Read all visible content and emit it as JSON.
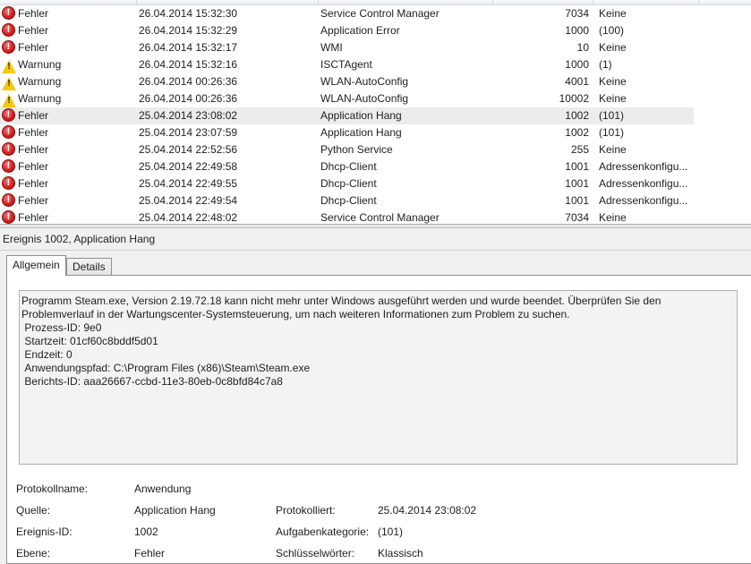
{
  "event_list": {
    "rows": [
      {
        "level": "Fehler",
        "type": "error",
        "date": "26.04.2014 15:32:30",
        "source": "Service Control Manager",
        "event_id": "7034",
        "task": "Keine"
      },
      {
        "level": "Fehler",
        "type": "error",
        "date": "26.04.2014 15:32:29",
        "source": "Application Error",
        "event_id": "1000",
        "task": "(100)"
      },
      {
        "level": "Fehler",
        "type": "error",
        "date": "26.04.2014 15:32:17",
        "source": "WMI",
        "event_id": "10",
        "task": "Keine"
      },
      {
        "level": "Warnung",
        "type": "warning",
        "date": "26.04.2014 15:32:16",
        "source": "ISCTAgent",
        "event_id": "1000",
        "task": "(1)"
      },
      {
        "level": "Warnung",
        "type": "warning",
        "date": "26.04.2014 00:26:36",
        "source": "WLAN-AutoConfig",
        "event_id": "4001",
        "task": "Keine"
      },
      {
        "level": "Warnung",
        "type": "warning",
        "date": "26.04.2014 00:26:36",
        "source": "WLAN-AutoConfig",
        "event_id": "10002",
        "task": "Keine"
      },
      {
        "level": "Fehler",
        "type": "error",
        "date": "25.04.2014 23:08:02",
        "source": "Application Hang",
        "event_id": "1002",
        "task": "(101)",
        "selected": true
      },
      {
        "level": "Fehler",
        "type": "error",
        "date": "25.04.2014 23:07:59",
        "source": "Application Hang",
        "event_id": "1002",
        "task": "(101)"
      },
      {
        "level": "Fehler",
        "type": "error",
        "date": "25.04.2014 22:52:56",
        "source": "Python Service",
        "event_id": "255",
        "task": "Keine"
      },
      {
        "level": "Fehler",
        "type": "error",
        "date": "25.04.2014 22:49:58",
        "source": "Dhcp-Client",
        "event_id": "1001",
        "task": "Adressenkonfigu..."
      },
      {
        "level": "Fehler",
        "type": "error",
        "date": "25.04.2014 22:49:55",
        "source": "Dhcp-Client",
        "event_id": "1001",
        "task": "Adressenkonfigu..."
      },
      {
        "level": "Fehler",
        "type": "error",
        "date": "25.04.2014 22:49:54",
        "source": "Dhcp-Client",
        "event_id": "1001",
        "task": "Adressenkonfigu..."
      },
      {
        "level": "Fehler",
        "type": "error",
        "date": "25.04.2014 22:48:02",
        "source": "Service Control Manager",
        "event_id": "7034",
        "task": "Keine"
      }
    ]
  },
  "detail": {
    "title": "Ereignis 1002, Application Hang",
    "tabs": {
      "general": "Allgemein",
      "details": "Details"
    },
    "description": "Programm Steam.exe, Version 2.19.72.18 kann nicht mehr unter Windows ausgeführt werden und wurde beendet. Überprüfen Sie den Problemverlauf in der Wartungscenter-Systemsteuerung, um nach weiteren Informationen zum Problem zu suchen.\n Prozess-ID: 9e0\n Startzeit: 01cf60c8bddf5d01\n Endzeit: 0\n Anwendungspfad: C:\\Program Files (x86)\\Steam\\Steam.exe\n Berichts-ID: aaa26667-ccbd-11e3-80eb-0c8bfd84c7a8",
    "props": {
      "log_name_label": "Protokollname:",
      "log_name": "Anwendung",
      "source_label": "Quelle:",
      "source": "Application Hang",
      "logged_label": "Protokolliert:",
      "logged": "25.04.2014 23:08:02",
      "event_id_label": "Ereignis-ID:",
      "event_id": "1002",
      "task_category_label": "Aufgabenkategorie:",
      "task_category": "(101)",
      "level_label": "Ebene:",
      "level": "Fehler",
      "keywords_label": "Schlüsselwörter:",
      "keywords": "Klassisch"
    }
  },
  "colors": {
    "error": "#d42020",
    "warning": "#f5c90f",
    "selected_row": "#ececec"
  }
}
